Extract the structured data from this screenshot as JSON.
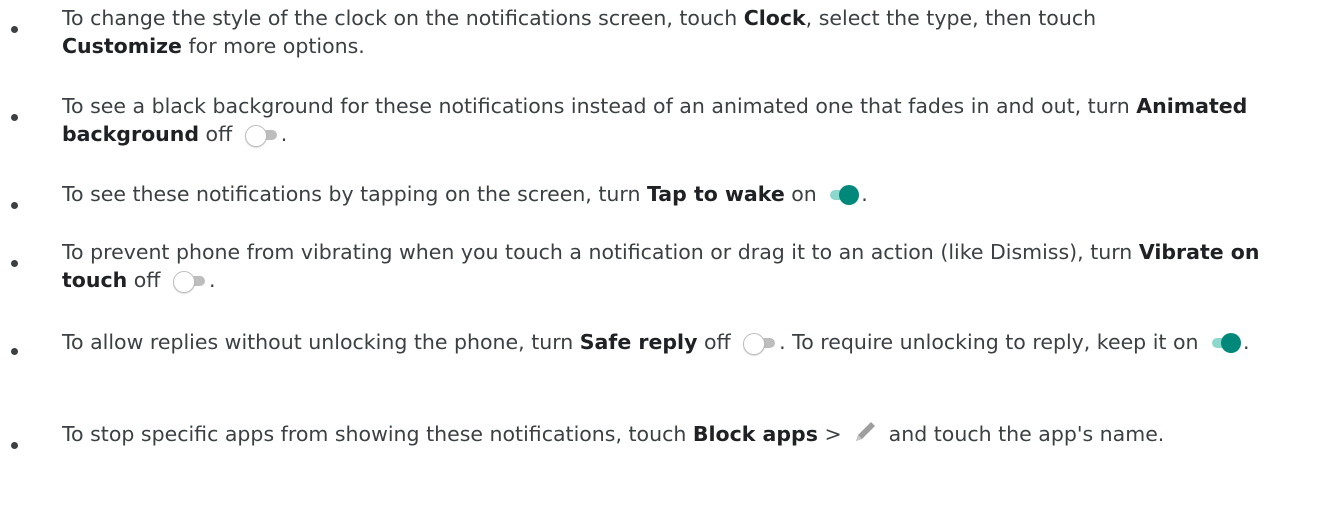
{
  "items": [
    {
      "p1": "To change the style of the clock on the notifications screen, touch ",
      "b1": "Clock",
      "p2": ", select the type, then touch",
      "b2": "Customize",
      "p3": " for more options."
    },
    {
      "p1": "To see a black background for these notifications instead of an animated one that fades in and out, turn ",
      "b1": "Animated background",
      "p2": " off ",
      "icon": "toggle-off-icon",
      "p3": "."
    },
    {
      "p1": "To see these notifications by tapping on the screen, turn ",
      "b1": "Tap to wake",
      "p2": " on ",
      "icon": "toggle-on-icon",
      "p3": "."
    },
    {
      "p1": "To prevent phone from vibrating when you touch a notification or drag it to an action (like Dismiss), turn ",
      "b1": "Vibrate on touch",
      "p2": " off ",
      "icon": "toggle-off-icon",
      "p3": "."
    },
    {
      "p1": "To allow replies without unlocking the phone, turn ",
      "b1": "Safe reply",
      "p2": " off ",
      "icon1": "toggle-off-icon",
      "p3": ". To require unlocking to reply, keep it on ",
      "icon2": "toggle-on-icon",
      "p4": "."
    },
    {
      "p1": "To stop specific apps from showing these notifications, touch ",
      "b1": "Block apps",
      "p2": " > ",
      "icon": "pencil-icon",
      "p3": " and touch the app's name."
    }
  ],
  "colors": {
    "text": "#3c4043",
    "toggle_on_thumb": "#00897b",
    "toggle_on_track": "#8ed7cc",
    "toggle_off_track": "#bdbdbd",
    "pencil": "#9e9e9e"
  }
}
